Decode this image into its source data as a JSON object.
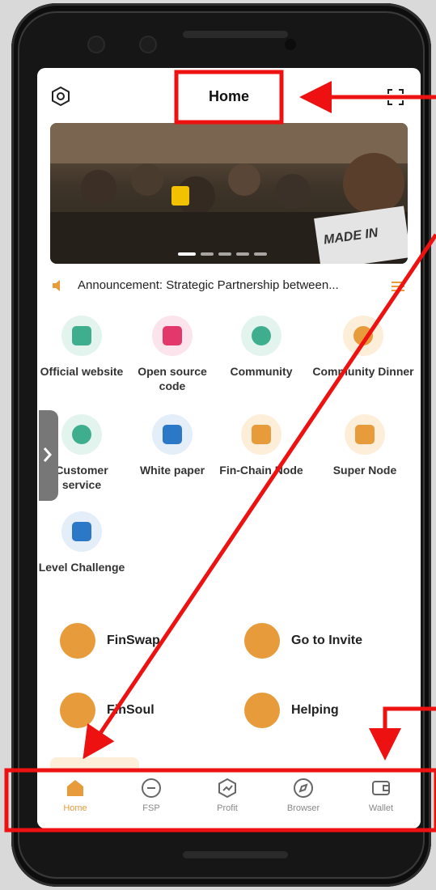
{
  "header": {
    "title": "Home"
  },
  "banner": {
    "overlay_text": "MADE IN"
  },
  "announcement": {
    "text": "Announcement: Strategic Partnership between..."
  },
  "grid": [
    {
      "label": "Official website",
      "icon": "monitor-icon",
      "color": "#3fae8f",
      "bg": "#e3f4ee"
    },
    {
      "label": "Open source code",
      "icon": "code-icon",
      "color": "#e2386b",
      "bg": "#fce4ec"
    },
    {
      "label": "Community",
      "icon": "chat-bubble-icon",
      "color": "#3fae8f",
      "bg": "#e3f4ee"
    },
    {
      "label": "Community Dinner",
      "icon": "fork-knife-icon",
      "color": "#e79b3b",
      "bg": "#fdeed9"
    },
    {
      "label": "Customer service",
      "icon": "chat-dots-icon",
      "color": "#3fae8f",
      "bg": "#e3f4ee"
    },
    {
      "label": "White paper",
      "icon": "book-icon",
      "color": "#2b78c6",
      "bg": "#e3eef9"
    },
    {
      "label": "Fin-Chain Node",
      "icon": "chain-node-icon",
      "color": "#e79b3b",
      "bg": "#fdeed9"
    },
    {
      "label": "Super Node",
      "icon": "cube-icon",
      "color": "#e79b3b",
      "bg": "#fdeed9"
    },
    {
      "label": "Level Challenge",
      "icon": "hierarchy-icon",
      "color": "#2b78c6",
      "bg": "#e3eef9"
    }
  ],
  "wide": [
    {
      "label": "FinSwap",
      "icon": "swap-icon"
    },
    {
      "label": "Go to Invite",
      "icon": "invite-icon"
    },
    {
      "label": "FinSoul",
      "icon": "heart-icon"
    },
    {
      "label": "Helping",
      "icon": "help-book-icon"
    }
  ],
  "nav": [
    {
      "label": "Home",
      "icon": "home-icon",
      "active": true
    },
    {
      "label": "FSP",
      "icon": "fsp-icon",
      "active": false
    },
    {
      "label": "Profit",
      "icon": "profit-icon",
      "active": false
    },
    {
      "label": "Browser",
      "icon": "compass-icon",
      "active": false
    },
    {
      "label": "Wallet",
      "icon": "wallet-icon",
      "active": false
    }
  ],
  "colors": {
    "accent": "#e79b3b",
    "annotation": "#ee1111",
    "active_nav": "#e79b3b"
  }
}
